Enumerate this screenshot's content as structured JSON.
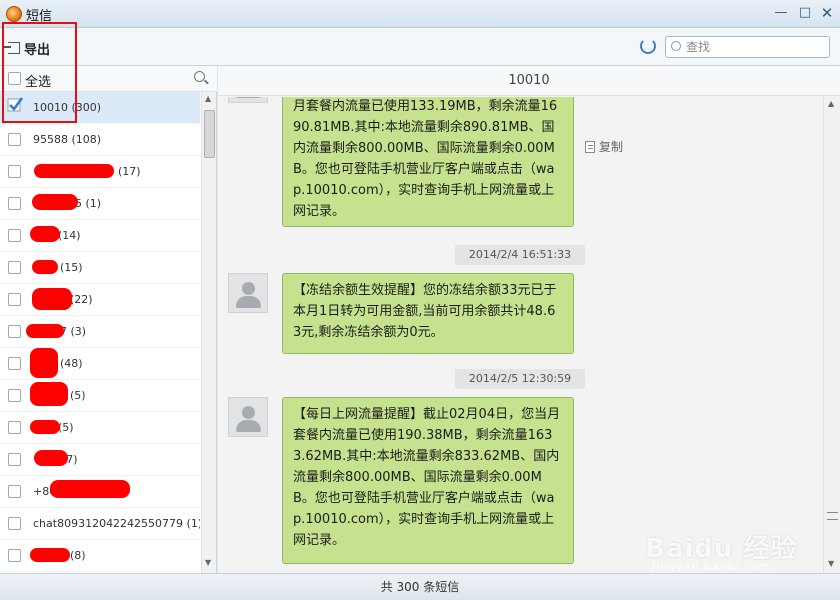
{
  "window": {
    "title": "短信",
    "min_glyph": "—",
    "max_glyph": "□",
    "close_glyph": "✕"
  },
  "toolbar": {
    "export_label": "导出",
    "search_placeholder": "查找"
  },
  "list": {
    "select_all_label": "全选",
    "contacts": [
      {
        "name": "10010 (300)",
        "selected": true
      },
      {
        "name": "95588 (108)",
        "selected": false
      },
      {
        "name": "(17)",
        "selected": false
      },
      {
        "name": "5 (1)",
        "selected": false
      },
      {
        "name": "(14)",
        "selected": false
      },
      {
        "name": "(15)",
        "selected": false
      },
      {
        "name": "(22)",
        "selected": false
      },
      {
        "name": "7 (3)",
        "selected": false
      },
      {
        "name": "(48)",
        "selected": false
      },
      {
        "name": "(5)",
        "selected": false
      },
      {
        "name": "(5)",
        "selected": false
      },
      {
        "name": "(7)",
        "selected": false
      },
      {
        "name": "+86 (25)",
        "selected": false
      },
      {
        "name": "chat809312042242550779 (1)",
        "selected": false
      },
      {
        "name": "(8)",
        "selected": false
      }
    ]
  },
  "conversation": {
    "title": "10010",
    "copy_label": "复制",
    "messages": [
      {
        "text": "月套餐内流量已使用133.19MB，剩余流量1690.81MB.其中:本地流量剩余890.81MB、国内流量剩余800.00MB、国际流量剩余0.00MB。您也可登陆手机营业厅客户端或点击（wap.10010.com），实时查询手机上网流量或上网记录。"
      },
      {
        "timestamp": "2014/2/4 16:51:33",
        "text": "【冻结余额生效提醒】您的冻结余额33元已于本月1日转为可用金额,当前可用余额共计48.63元,剩余冻结余额为0元。"
      },
      {
        "timestamp": "2014/2/5 12:30:59",
        "text": "【每日上网流量提醒】截止02月04日，您当月套餐内流量已使用190.38MB，剩余流量1633.62MB.其中:本地流量剩余833.62MB、国内流量剩余800.00MB、国际流量剩余0.00MB。您也可登陆手机营业厅客户端或点击（wap.10010.com），实时查询手机上网流量或上网记录。"
      }
    ]
  },
  "status": {
    "text": "共 300 条短信"
  },
  "watermark": {
    "brand": "Baidu 经验",
    "url": "jingyan.baidu.com"
  },
  "colors": {
    "bubble": "#c6e28e",
    "highlight": "#e01010",
    "redaction": "#ff0000",
    "accent": "#3b7dc4"
  }
}
